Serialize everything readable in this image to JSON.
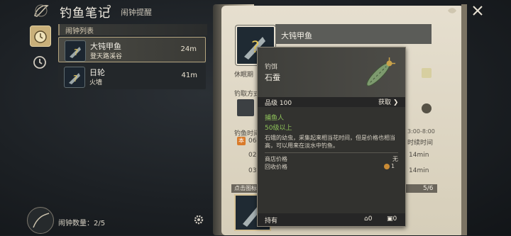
{
  "header": {
    "title": "钓鱼笔记",
    "help": "?",
    "subtitle": "闹钟提醒"
  },
  "list": {
    "header": "闹钟列表",
    "rows": [
      {
        "name": "大钝甲鱼",
        "location": "登天路溪谷",
        "distance": "24m"
      },
      {
        "name": "日轮",
        "location": "火墙",
        "distance": "41m"
      }
    ],
    "count_label": "闹钟数量：2/5"
  },
  "detail": {
    "fish_name": "大钝甲鱼",
    "rest_label": "休眠期",
    "method_label": "钓取方式",
    "time_label": "钓鱼时间",
    "time_range": "3:00-8:00",
    "hint_label": "点击图标",
    "page": "5/6",
    "col_right_1": "14min",
    "col_right_2": "14min",
    "col_right_3": "14min",
    "time_suffix": "时续时间",
    "row_label_1": "06",
    "row_label_2": "02",
    "row_label_3": "03",
    "badge": "本"
  },
  "tooltip": {
    "type": "钓饵",
    "name": "石蚕",
    "grade": "品级 100",
    "obtain": "获取",
    "role": "捕鱼人",
    "level": "50级以上",
    "description": "石蛾的幼虫，采集起来相当花时间，但是价格也相当高，可以用来在淡水中钓鱼。",
    "shop_label": "商店价格",
    "shop_value": "无",
    "recycle_label": "回收价格",
    "recycle_value": "1",
    "hold_label": "持有",
    "own_house": "0",
    "own_bag": "0"
  },
  "colors": {
    "accent": "#c9b07a",
    "highlight_green": "#8fc45a"
  }
}
